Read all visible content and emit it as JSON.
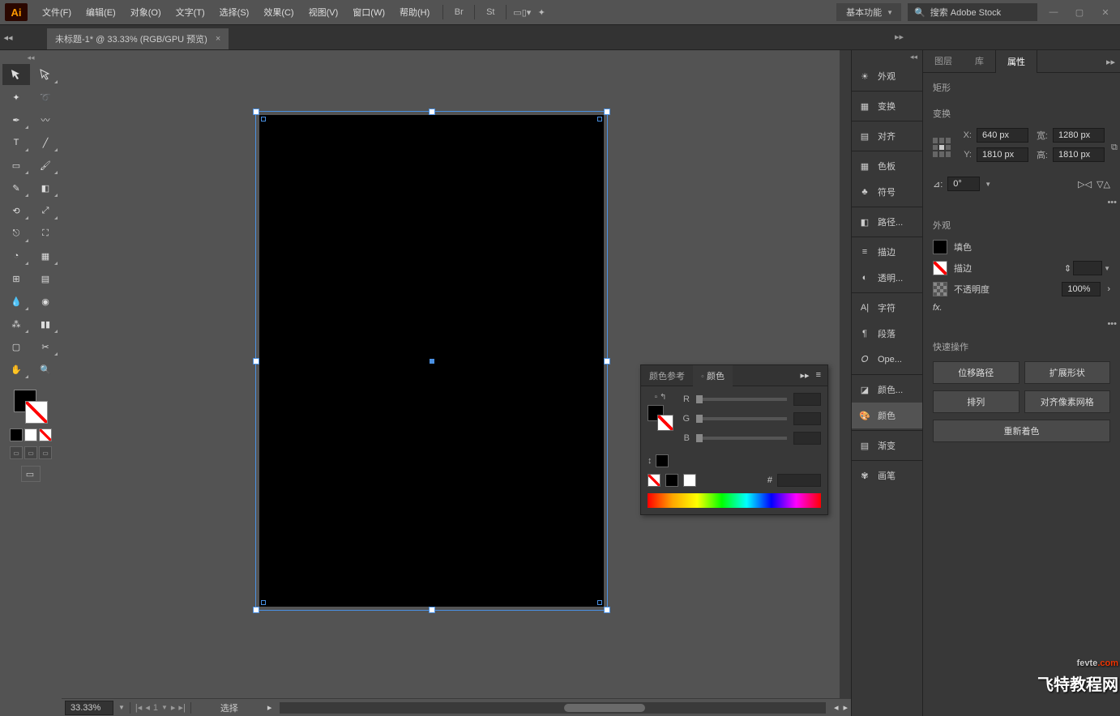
{
  "menu": [
    "文件(F)",
    "编辑(E)",
    "对象(O)",
    "文字(T)",
    "选择(S)",
    "效果(C)",
    "视图(V)",
    "窗口(W)",
    "帮助(H)"
  ],
  "workspace": "基本功能",
  "search_placeholder": "搜索 Adobe Stock",
  "doc_tab": "未标题-1* @ 33.33% (RGB/GPU 预览)",
  "zoom": "33.33%",
  "artboard_num": "1",
  "status_text": "选择",
  "color_panel": {
    "tab1": "颜色参考",
    "tab2": "颜色",
    "channels": [
      "R",
      "G",
      "B"
    ],
    "hex_label": "#"
  },
  "mid_dock": [
    "外观",
    "变换",
    "对齐",
    "色板",
    "符号",
    "路径...",
    "描边",
    "透明...",
    "字符",
    "段落",
    "Ope...",
    "颜色...",
    "颜色",
    "渐变",
    "画笔"
  ],
  "right_tabs": [
    "图层",
    "库",
    "属性"
  ],
  "shape_label": "矩形",
  "transform": {
    "title": "变换",
    "x_label": "X:",
    "y_label": "Y:",
    "w_label": "宽:",
    "h_label": "高:",
    "x": "640 px",
    "y": "1810 px",
    "w": "1280 px",
    "h": "1810 px",
    "angle_label": "⊿:",
    "angle": "0°"
  },
  "appearance": {
    "title": "外观",
    "fill": "填色",
    "stroke": "描边",
    "opacity_label": "不透明度",
    "opacity": "100%",
    "fx": "fx."
  },
  "quick": {
    "title": "快速操作",
    "b1": "位移路径",
    "b2": "扩展形状",
    "b3": "排列",
    "b4": "对齐像素网格",
    "b5": "重新着色"
  },
  "watermark": {
    "l1a": "fevte",
    "l1b": ".com",
    "l2": "飞特教程网"
  },
  "more": "•••"
}
